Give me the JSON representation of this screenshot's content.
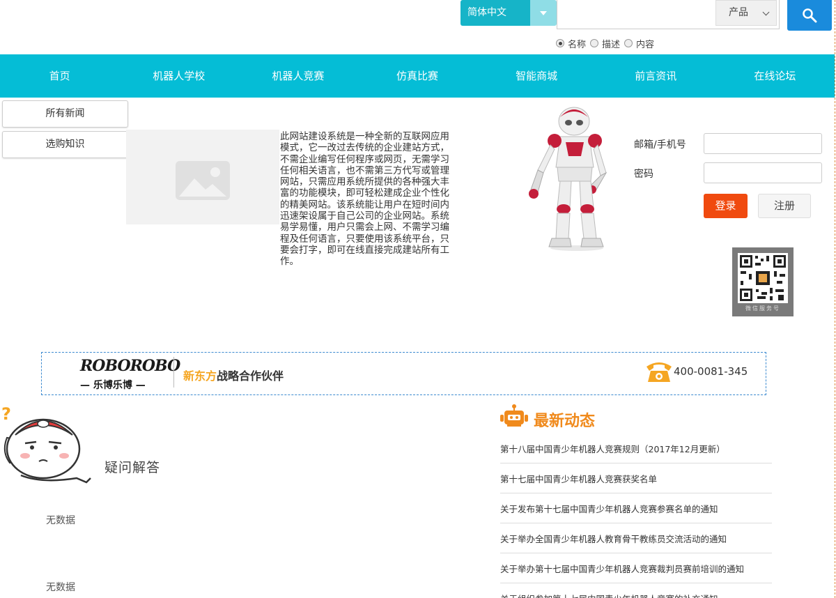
{
  "header": {
    "language": "简体中文",
    "search_placeholder": "",
    "search_type": "产品",
    "search_fields": [
      {
        "label": "名称",
        "checked": true
      },
      {
        "label": "描述",
        "checked": false
      },
      {
        "label": "内容",
        "checked": false
      }
    ]
  },
  "nav": [
    "首页",
    "机器人学校",
    "机器人竞赛",
    "仿真比赛",
    "智能商城",
    "前言资讯",
    "在线论坛"
  ],
  "sidebar": [
    "所有新闻",
    "选购知识"
  ],
  "intro": "此网站建设系统是一种全新的互联网应用模式，它一改过去传统的企业建站方式，不需企业编写任何程序或网页，无需学习任何相关语言，也不需第三方代写或管理网站，只需应用系统所提供的各种强大丰富的功能模块，即可轻松建成企业个性化的精美网站。该系统能让用户在短时间内迅速架设属于自己公司的企业网站。系统易学易懂，用户只需会上网、不需学习编程及任何语言，只要使用该系统平台，只要会打字，即可在线直接完成建站所有工作。",
  "login": {
    "account_label": "邮箱/手机号",
    "password_label": "密码",
    "login_button": "登录",
    "register_button": "注册"
  },
  "qr_caption": "微信服务号",
  "banner": {
    "logo_top": "ROBOROBO",
    "logo_bottom": "— 乐博乐博 —",
    "partner_brand": "新东方",
    "partner_text": "战略合作伙伴",
    "phone": "400-0081-345"
  },
  "faq": {
    "title": "疑问解答",
    "empty_1": "无数据",
    "empty_2": "无数据"
  },
  "news": {
    "heading": "最新动态",
    "items": [
      "第十八届中国青少年机器人竞赛规则（2017年12月更新）",
      "第十七届中国青少年机器人竞赛获奖名单",
      "关于发布第十七届中国青少年机器人竞赛参赛名单的通知",
      "关于举办全国青少年机器人教育骨干教练员交流活动的通知",
      "关于举办第十七届中国青少年机器人竞赛裁判员赛前培训的通知",
      "关于组织参加第十七届中国青少年机器人竞赛的补充通知"
    ]
  },
  "colors": {
    "nav": "#05bdd6",
    "search_button": "#1a8bdc",
    "login_button": "#f04a0f",
    "news_heading": "#f08a1c"
  }
}
